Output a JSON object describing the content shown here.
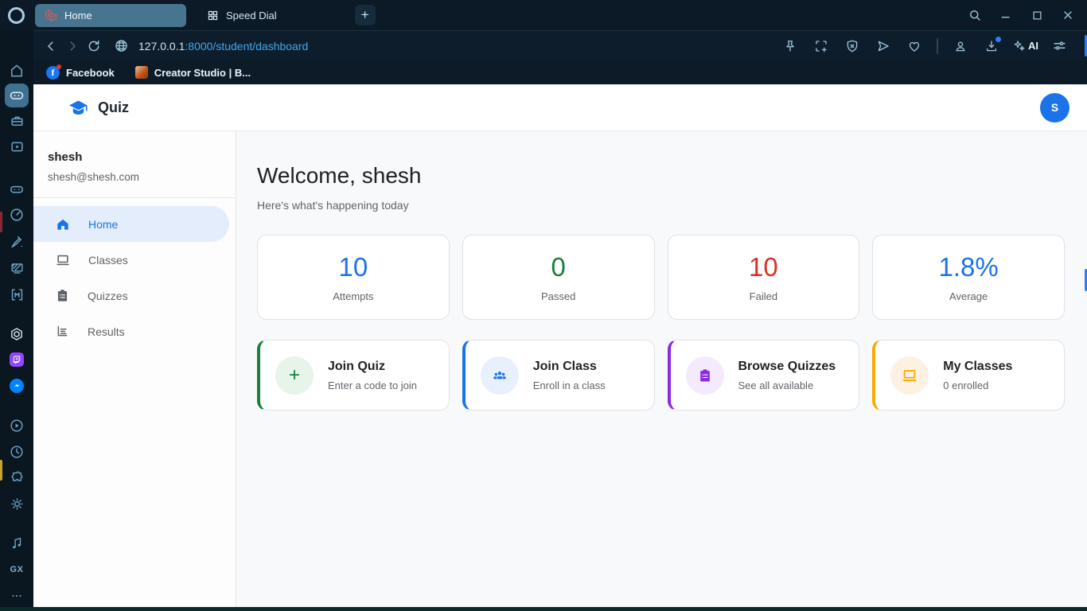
{
  "browser": {
    "tabs": [
      {
        "label": "Home",
        "active": true,
        "favicon": "laravel-icon"
      },
      {
        "label": "Speed Dial",
        "active": false,
        "favicon": "grid-icon"
      }
    ],
    "new_tab_label": "+",
    "window_controls": [
      "search-icon",
      "minimize-icon",
      "maximize-icon",
      "close-icon"
    ],
    "url": {
      "host": "127.0.0.1",
      "path": ":8000/student/dashboard"
    },
    "address_icons_left": [
      "back-icon",
      "forward-icon",
      "reload-icon",
      "globe-icon"
    ],
    "address_icons_right": [
      "pin-icon",
      "snapshot-icon",
      "adblock-shield-icon",
      "send-icon",
      "heart-icon",
      "profile-icon",
      "download-icon",
      "ai-sparkle-icon",
      "tune-icon"
    ],
    "ai_label": "AI",
    "bookmarks": [
      {
        "label": "Facebook",
        "color": "#1877f2",
        "glyph": "f"
      },
      {
        "label": "Creator Studio | B..."
      }
    ],
    "gx_sidebar_icons": [
      "home-icon",
      "gx-corner-controller-icon",
      "toolkit-icon",
      "video-popout-icon",
      "console-icon",
      "speedometer-icon",
      "cleaner-broom-icon",
      "wallpaper-icon",
      "mods-icon",
      "chatgpt-icon",
      "twitch-icon",
      "messenger-icon",
      "play-circle-icon",
      "history-clock-icon",
      "extensions-puzzle-icon",
      "settings-gear-icon",
      "music-note-icon",
      "gx-label",
      "more-dots-icon"
    ],
    "gx_label": "GX",
    "app_colors": {
      "twitch": "#9146ff",
      "messenger": "#0084ff"
    }
  },
  "header": {
    "title": "Quiz",
    "logo": "graduation-cap-icon",
    "avatar_initial": "S",
    "avatar_color": "#1a73e8"
  },
  "sidebar": {
    "user_name": "shesh",
    "user_email": "shesh@shesh.com",
    "active_color": "#1a73e8",
    "active_bg": "#e4edfb",
    "items": [
      {
        "label": "Home",
        "icon": "home-icon",
        "active": true
      },
      {
        "label": "Classes",
        "icon": "laptop-icon",
        "active": false
      },
      {
        "label": "Quizzes",
        "icon": "clipboard-icon",
        "active": false
      },
      {
        "label": "Results",
        "icon": "results-list-icon",
        "active": false
      }
    ]
  },
  "main": {
    "welcome_title": "Welcome, shesh",
    "welcome_subtitle": "Here's what's happening today",
    "stats": [
      {
        "value": "10",
        "label": "Attempts",
        "color": "#1a73e8"
      },
      {
        "value": "0",
        "label": "Passed",
        "color": "#188038"
      },
      {
        "value": "10",
        "label": "Failed",
        "color": "#d93025"
      },
      {
        "value": "1.8%",
        "label": "Average",
        "color": "#1a73e8"
      }
    ],
    "actions": [
      {
        "title": "Join Quiz",
        "subtitle": "Enter a code to join",
        "accent": "#188038",
        "icon_bg": "#e6f4ea",
        "icon": "plus-icon",
        "icon_glyph": "+"
      },
      {
        "title": "Join Class",
        "subtitle": "Enroll in a class",
        "accent": "#1a73e8",
        "icon_bg": "#e8f0fe",
        "icon": "people-group-icon"
      },
      {
        "title": "Browse Quizzes",
        "subtitle": "See all available",
        "accent": "#8a2be2",
        "icon_bg": "#f4e9fd",
        "icon": "clipboard-icon"
      },
      {
        "title": "My Classes",
        "subtitle": "0 enrolled",
        "accent": "#f9ab00",
        "icon_bg": "#fdf1e2",
        "icon": "laptop-icon"
      }
    ]
  }
}
